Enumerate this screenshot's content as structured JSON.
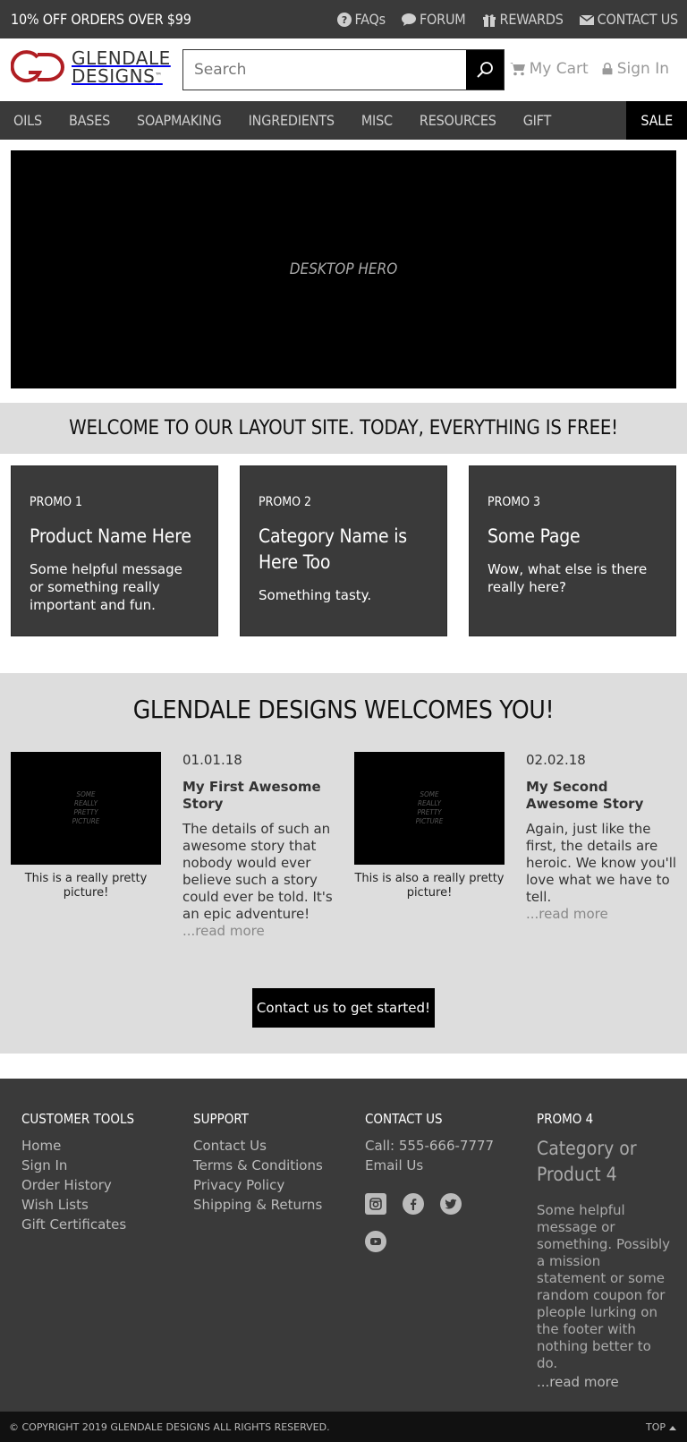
{
  "topbar": {
    "promo": "10% OFF ORDERS OVER $99",
    "links": {
      "faqs": "FAQs",
      "forum": "FORUM",
      "rewards": "REWARDS",
      "contact": "CONTACT US"
    }
  },
  "header": {
    "logo_line1": "GLENDALE",
    "logo_line2": "DESIGNS",
    "logo_tm": "™",
    "search_placeholder": "Search",
    "cart": "My Cart",
    "signin": "Sign In"
  },
  "nav": {
    "items": [
      "OILS",
      "BASES",
      "SOAPMAKING",
      "INGREDIENTS",
      "MISC",
      "RESOURCES",
      "GIFT CERTIFICATES"
    ],
    "sale": "SALE"
  },
  "hero": {
    "label": "DESKTOP HERO"
  },
  "welcome": {
    "text": "WELCOME TO OUR LAYOUT SITE. TODAY, EVERYTHING IS FREE!"
  },
  "promos": [
    {
      "tag": "PROMO 1",
      "title": "Product Name Here",
      "body": "Some helpful message or something really important and fun."
    },
    {
      "tag": "PROMO 2",
      "title": "Category Name is Here Too",
      "body": "Something tasty."
    },
    {
      "tag": "PROMO 3",
      "title": "Some Page",
      "body": "Wow, what else is there really here?"
    }
  ],
  "stories": {
    "heading": "GLENDALE DESIGNS WELCOMES YOU!",
    "items": [
      {
        "pic_label": "SOME REALLY PRETTY PICTURE",
        "caption": "This is a really pretty picture!",
        "date": "01.01.18",
        "title": "My First Awesome Story",
        "body": "The details of such an awesome story that nobody would ever believe such a story could ever be told. It's an epic adventure!",
        "more": "...read more"
      },
      {
        "pic_label": "SOME REALLY PRETTY PICTURE",
        "caption": "This is also a really pretty picture!",
        "date": "02.02.18",
        "title": "My Second Awesome Story",
        "body": "Again, just like the first, the details are heroic. We know you'll love what we have to tell.",
        "more": "...read more"
      }
    ],
    "cta": "Contact us to get started!"
  },
  "footer": {
    "tools": {
      "heading": "CUSTOMER TOOLS",
      "links": [
        "Home",
        "Sign In",
        "Order History",
        "Wish Lists",
        "Gift Certificates"
      ]
    },
    "support": {
      "heading": "SUPPORT",
      "links": [
        "Contact Us",
        "Terms & Conditions",
        "Privacy Policy",
        "Shipping & Returns"
      ]
    },
    "contact": {
      "heading": "CONTACT US",
      "phone": "Call: 555-666-7777",
      "email": "Email Us",
      "social": [
        "instagram-icon",
        "facebook-icon",
        "twitter-icon",
        "youtube-icon"
      ]
    },
    "promo": {
      "tag": "PROMO 4",
      "title": "Category or Product 4",
      "body": "Some helpful message or something. Possibly a mission statement or some random coupon for pleople lurking on the footer with nothing better to do.",
      "more": "...read more"
    }
  },
  "bottombar": {
    "copyright": "© COPYRIGHT 2019 GLENDALE DESIGNS ALL RIGHTS RESERVED.",
    "top": "TOP"
  },
  "colors": {
    "dark": "#3a3a3a",
    "brand_red": "#b01e23",
    "light_gray": "#dddddd",
    "black": "#000000"
  }
}
